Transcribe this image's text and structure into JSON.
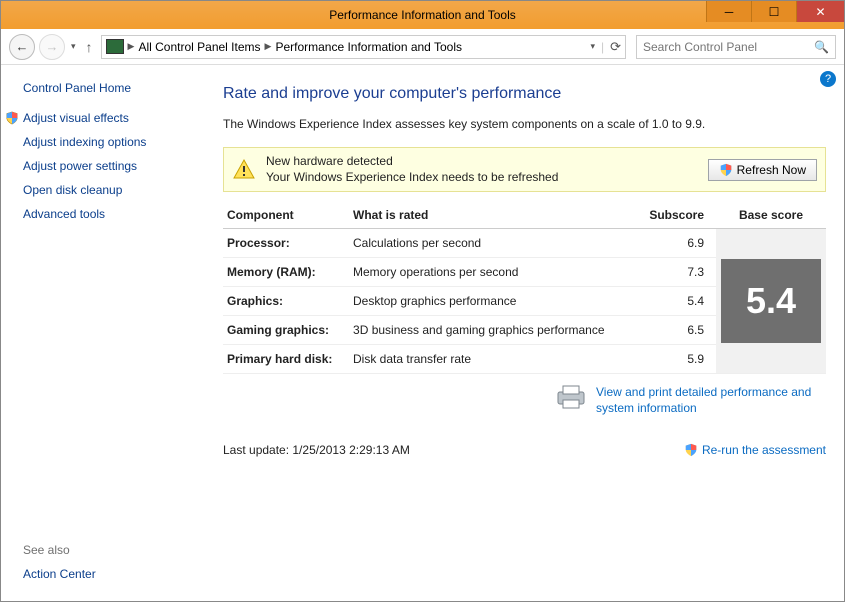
{
  "window": {
    "title": "Performance Information and Tools"
  },
  "breadcrumb": {
    "item1": "All Control Panel Items",
    "item2": "Performance Information and Tools"
  },
  "search": {
    "placeholder": "Search Control Panel"
  },
  "sidebar": {
    "home": "Control Panel Home",
    "links": {
      "visual": "Adjust visual effects",
      "indexing": "Adjust indexing options",
      "power": "Adjust power settings",
      "cleanup": "Open disk cleanup",
      "advanced": "Advanced tools"
    },
    "seealso_label": "See also",
    "action_center": "Action Center"
  },
  "main": {
    "heading": "Rate and improve your computer's performance",
    "description": "The Windows Experience Index assesses key system components on a scale of 1.0 to 9.9.",
    "alert": {
      "line1": "New hardware detected",
      "line2": "Your Windows Experience Index needs to be refreshed"
    },
    "refresh_btn": "Refresh Now",
    "table": {
      "headers": {
        "component": "Component",
        "rated": "What is rated",
        "subscore": "Subscore",
        "basescore": "Base score"
      },
      "rows": [
        {
          "name": "Processor:",
          "rated": "Calculations per second",
          "sub": "6.9"
        },
        {
          "name": "Memory (RAM):",
          "rated": "Memory operations per second",
          "sub": "7.3"
        },
        {
          "name": "Graphics:",
          "rated": "Desktop graphics performance",
          "sub": "5.4"
        },
        {
          "name": "Gaming graphics:",
          "rated": "3D business and gaming graphics performance",
          "sub": "6.5"
        },
        {
          "name": "Primary hard disk:",
          "rated": "Disk data transfer rate",
          "sub": "5.9"
        }
      ],
      "base_score": "5.4"
    },
    "detail_link": "View and print detailed performance and system information",
    "last_update": "Last update: 1/25/2013 2:29:13 AM",
    "rerun": "Re-run the assessment"
  }
}
